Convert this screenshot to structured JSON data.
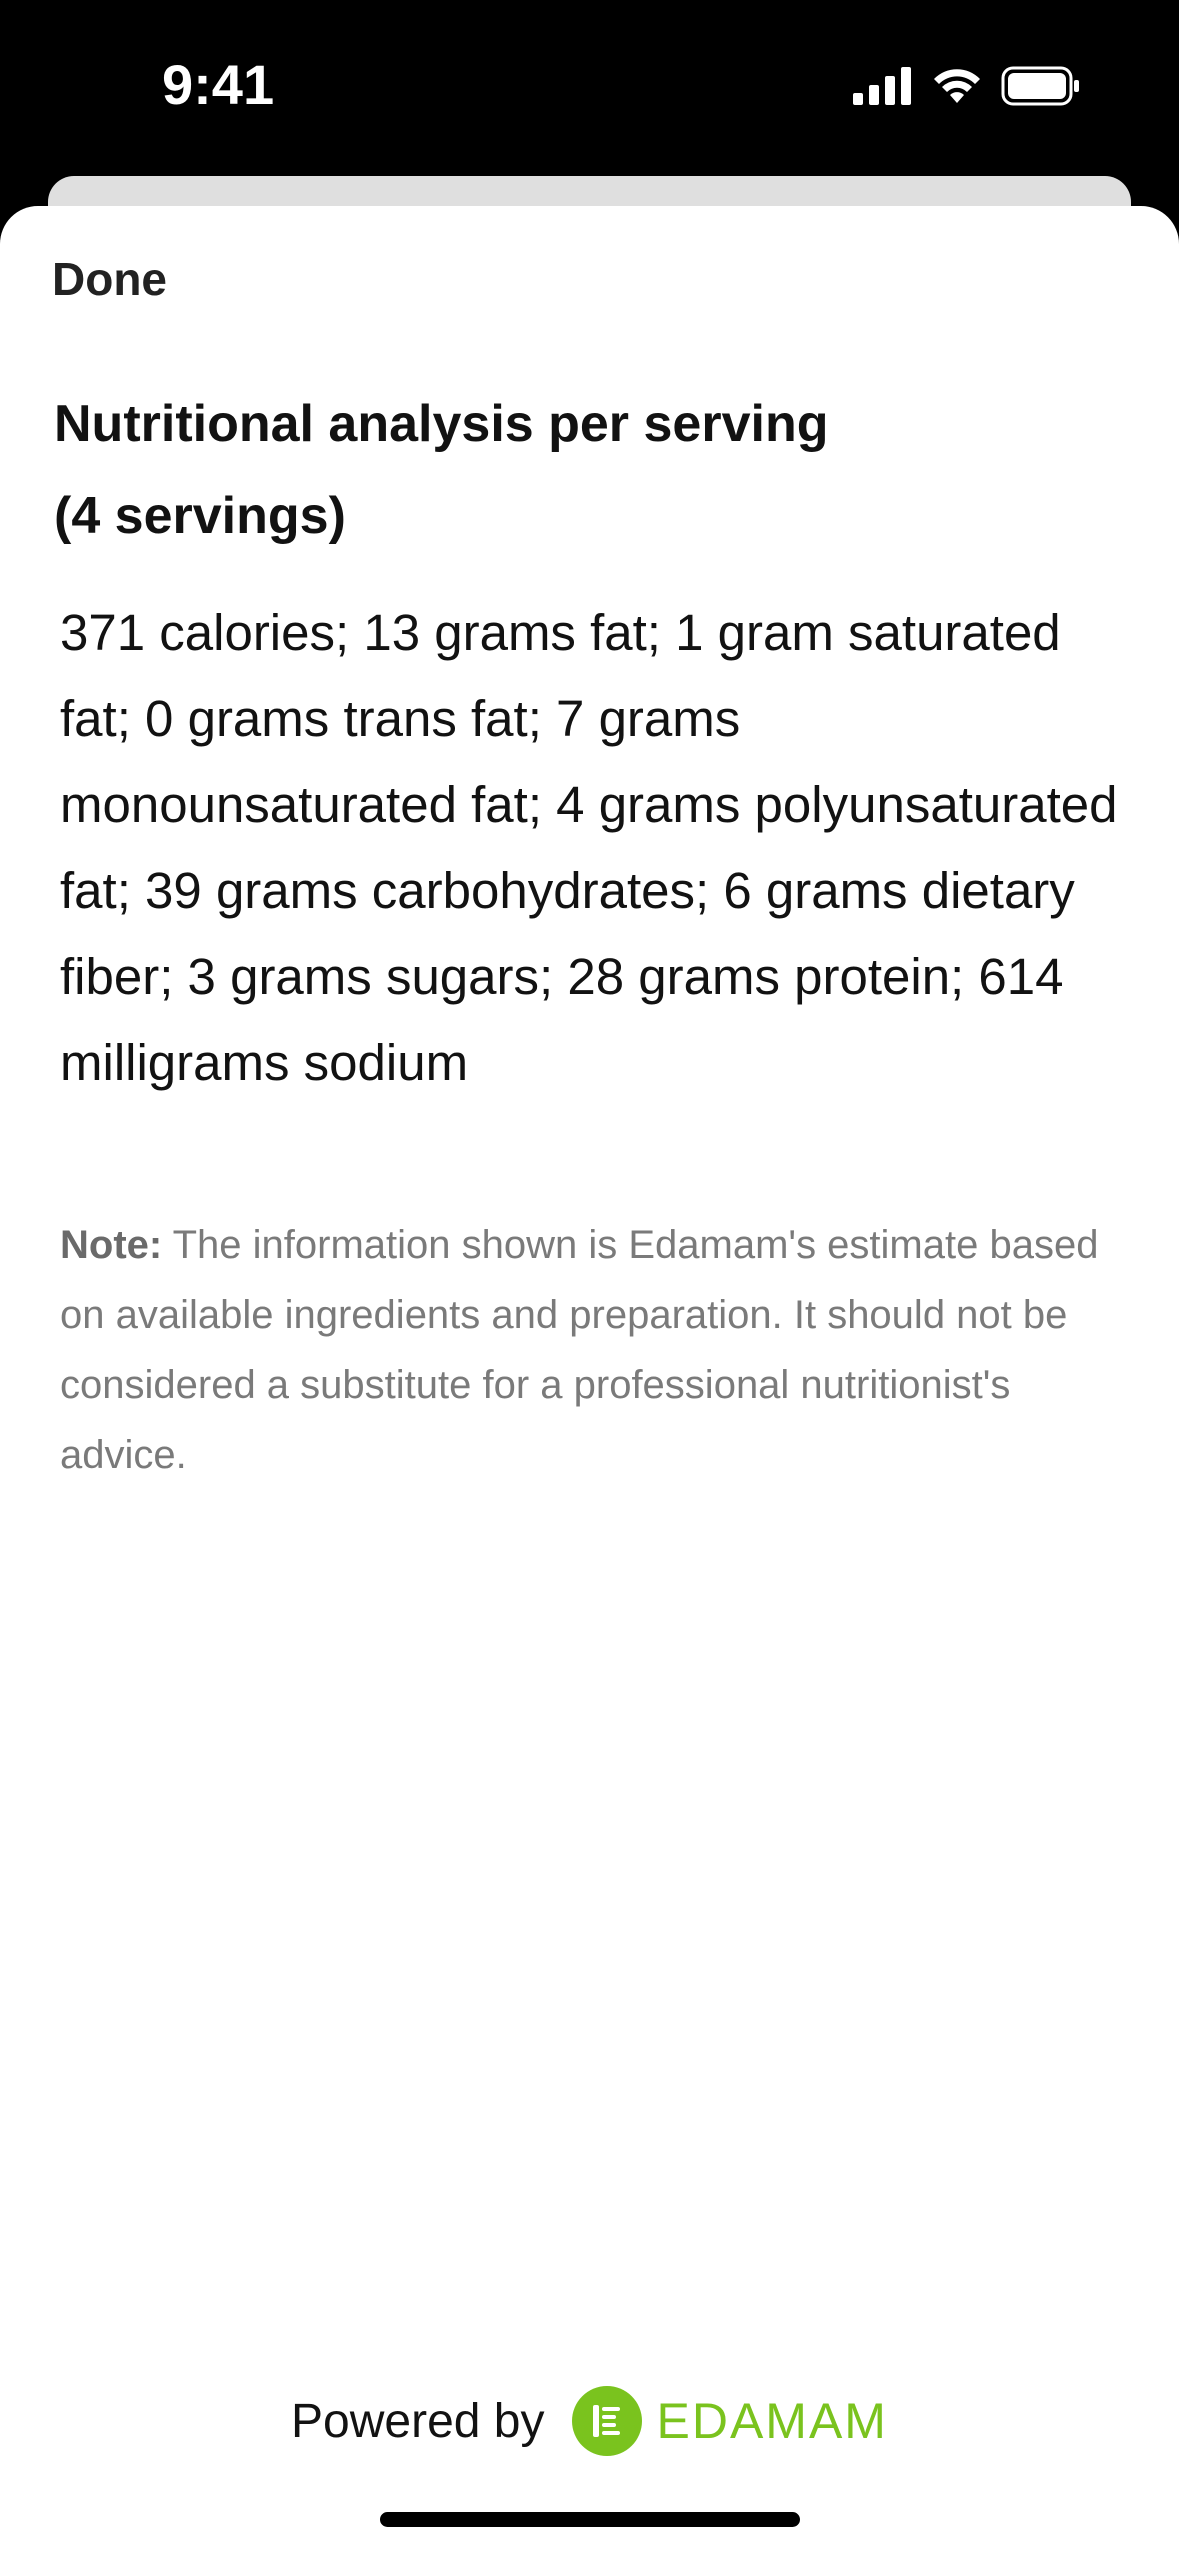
{
  "status_bar": {
    "time": "9:41",
    "icons": [
      "cellular-signal-icon",
      "wifi-icon",
      "battery-icon"
    ]
  },
  "sheet": {
    "done_label": "Done",
    "title_line1": "Nutritional analysis per serving",
    "title_line2": "(4 servings)",
    "nutrition_text": "371 calories; 13 grams fat; 1 gram saturated fat; 0 grams trans fat; 7 grams monounsaturated fat; 4 grams polyunsaturated fat; 39 grams carbohydrates; 6 grams dietary fiber; 3 grams sugars; 28 grams protein; 614 milligrams sodium",
    "note_label": "Note:",
    "note_text": " The information shown is Edamam's estimate based on available ingredients and preparation. It should not be considered a substitute for a professional nutritionist's advice."
  },
  "footer": {
    "powered_by": "Powered by",
    "brand": "EDAMAM",
    "brand_color": "#7ac31e"
  }
}
